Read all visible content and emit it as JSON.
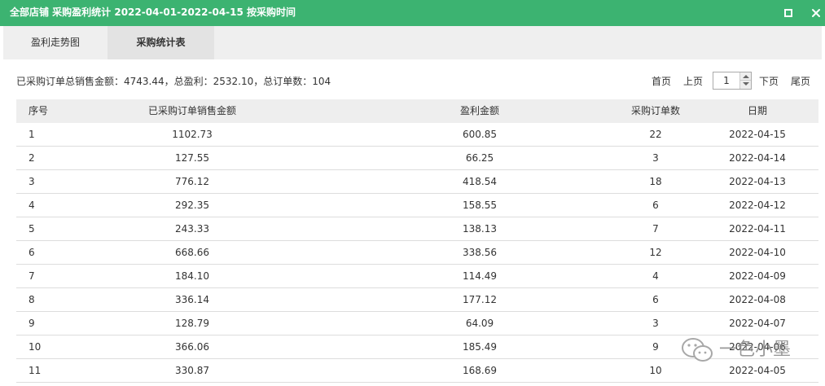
{
  "window": {
    "title": "全部店铺 采购盈利统计 2022-04-01-2022-04-15 按采购时间",
    "maximize_icon": "maximize-icon",
    "close_icon": "close-icon",
    "accent_color": "#3cb371"
  },
  "tabs": [
    {
      "label": "盈利走势图",
      "active": false
    },
    {
      "label": "采购统计表",
      "active": true
    }
  ],
  "summary": "已采购订单总销售金额：4743.44，总盈利：2532.10，总订单数：104",
  "pager": {
    "first": "首页",
    "prev": "上页",
    "page": "1",
    "next": "下页",
    "last": "尾页"
  },
  "table": {
    "columns": [
      "序号",
      "已采购订单销售金额",
      "盈利金额",
      "采购订单数",
      "日期"
    ],
    "rows": [
      [
        "1",
        "1102.73",
        "600.85",
        "22",
        "2022-04-15"
      ],
      [
        "2",
        "127.55",
        "66.25",
        "3",
        "2022-04-14"
      ],
      [
        "3",
        "776.12",
        "418.54",
        "18",
        "2022-04-13"
      ],
      [
        "4",
        "292.35",
        "158.55",
        "6",
        "2022-04-12"
      ],
      [
        "5",
        "243.33",
        "138.13",
        "7",
        "2022-04-11"
      ],
      [
        "6",
        "668.66",
        "338.56",
        "12",
        "2022-04-10"
      ],
      [
        "7",
        "184.10",
        "114.49",
        "4",
        "2022-04-09"
      ],
      [
        "8",
        "336.14",
        "177.12",
        "6",
        "2022-04-08"
      ],
      [
        "9",
        "128.79",
        "64.09",
        "3",
        "2022-04-07"
      ],
      [
        "10",
        "366.06",
        "185.49",
        "9",
        "2022-04-06"
      ],
      [
        "11",
        "330.87",
        "168.69",
        "10",
        "2022-04-05"
      ]
    ]
  },
  "watermark": {
    "text": "一色小墨",
    "icon": "wechat-icon"
  }
}
